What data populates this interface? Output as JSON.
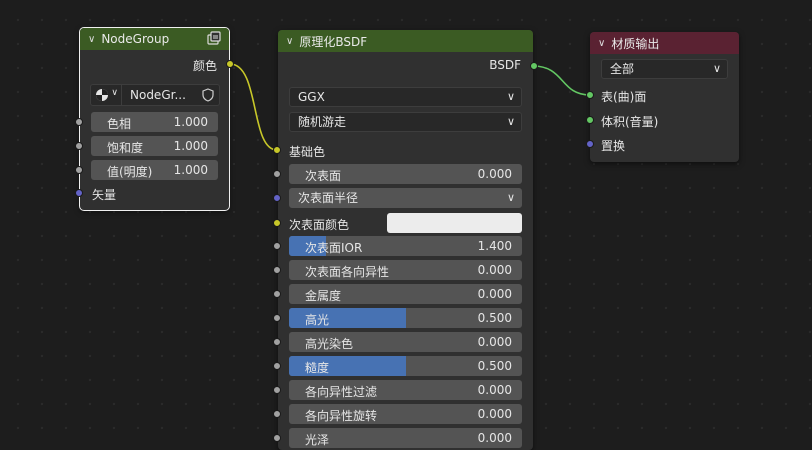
{
  "colors": {
    "socket_color": "#c7c729",
    "socket_float": "#a1a1a1",
    "socket_vector": "#6363c7",
    "socket_shader": "#63c763",
    "header_group": "#3b5b23",
    "header_bsdf": "#3b5b23",
    "header_output": "#5a2232",
    "slider_fill": "#4772b3"
  },
  "nodegroup": {
    "title": "NodeGroup",
    "output_color": "颜色",
    "group_name": "NodeGr...",
    "inputs": [
      {
        "label": "色相",
        "value": "1.000"
      },
      {
        "label": "饱和度",
        "value": "1.000"
      },
      {
        "label": "值(明度)",
        "value": "1.000"
      }
    ],
    "vector_label": "矢量"
  },
  "bsdf": {
    "title": "原理化BSDF",
    "output": "BSDF",
    "distribution": "GGX",
    "subsurface_method": "随机游走",
    "base_color": "基础色",
    "subsurface": {
      "label": "次表面",
      "value": "0.000"
    },
    "subsurface_radius": "次表面半径",
    "subsurface_color": "次表面颜色",
    "subsurface_color_swatch": "#ececec",
    "sliders": [
      {
        "label": "次表面IOR",
        "value": "1.400",
        "fill": 0.16
      },
      {
        "label": "次表面各向异性",
        "value": "0.000",
        "fill": 0
      },
      {
        "label": "金属度",
        "value": "0.000",
        "fill": 0
      },
      {
        "label": "高光",
        "value": "0.500",
        "fill": 0.5
      },
      {
        "label": "高光染色",
        "value": "0.000",
        "fill": 0
      },
      {
        "label": "糙度",
        "value": "0.500",
        "fill": 0.5
      },
      {
        "label": "各向异性过滤",
        "value": "0.000",
        "fill": 0
      },
      {
        "label": "各向异性旋转",
        "value": "0.000",
        "fill": 0
      },
      {
        "label": "光泽",
        "value": "0.000",
        "fill": 0
      }
    ]
  },
  "output": {
    "title": "材质输出",
    "target": "全部",
    "surface": "表(曲)面",
    "volume": "体积(音量)",
    "displacement": "置换"
  }
}
